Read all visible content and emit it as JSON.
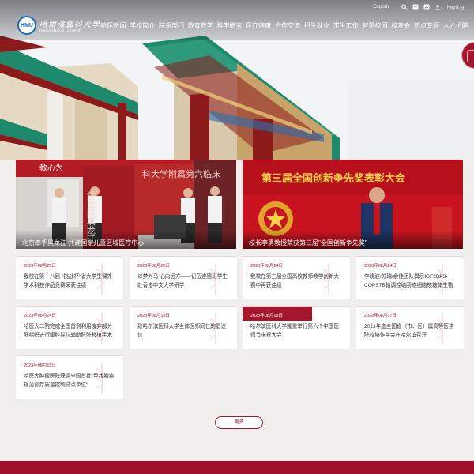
{
  "header": {
    "english_label": "English",
    "login_label": "上网认证",
    "logo": {
      "cn": "哈爾濱醫科大學",
      "en": "Harbin Medical University",
      "seal_text": "HMU"
    },
    "nav": [
      "哈医新闻",
      "学校简介",
      "院系部门",
      "教育教学",
      "科学研究",
      "医疗健康",
      "合作交流",
      "招生就业",
      "学生工作",
      "智慧校园",
      "校友会",
      "热点专题",
      "人才招聘"
    ]
  },
  "hero": {
    "sign_lines": [
      "教心",
      "为"
    ],
    "colors": {
      "brand": "#a5152d",
      "roof_green": "#1e8a6d",
      "roof_red": "#8c1a1a",
      "wall": "#c9a46a"
    }
  },
  "features": [
    {
      "caption": "北京牵手黑龙江 共建国家儿童区域医疗中心",
      "banner": "科大学附属第六临床",
      "banner2": "重医院黑龙江"
    },
    {
      "caption": "校长李勇教授荣获第三届\"全国创新争先奖\"",
      "banner": "第三届全国创新争先奖表彰大会"
    }
  ],
  "news": [
    {
      "date": "2023年08月25日",
      "title": "我校在第十八届 \"挑战杯\"省大学生课外学术科技作品竞赛荣获佳绩"
    },
    {
      "date": "2023年08月25日",
      "title": "以梦为马 心向远方——记伍连德班学生赴香港中文大学研学"
    },
    {
      "date": "2023年08月24日",
      "title": "我校在第三届全国高校教师教学创新大赛中再获佳绩"
    },
    {
      "date": "2023年08月24日",
      "title": "李晓波/苏瑞/余佳团队揭示IGF2BP3-COPS7B轴调控结肠癌细胞核糖体生物"
    },
    {
      "date": "2023年08月24日",
      "title": "哈医大二院完成全国首例利用废弃部分肝组织进行腹腔异位辅助肝脏移植手术"
    },
    {
      "date": "2023年08月18日",
      "title": "致哈尔滨医科大学全体医师同仁的倡议信"
    },
    {
      "date": "2023年08月18日",
      "title": "哈尔滨医科大学隆重举行第六个中国医师节庆祝大会"
    },
    {
      "date": "2023年08月17日",
      "title": "2023年度全国省（市、区）属高等医学院校协作年会在哈尔滨召开"
    },
    {
      "date": "2023年08月15日",
      "title": "哈医大肿瘤医院获评全国首批\"甲状腺癌规范诊疗质量控制试点单位\""
    }
  ],
  "more_label": "更多"
}
